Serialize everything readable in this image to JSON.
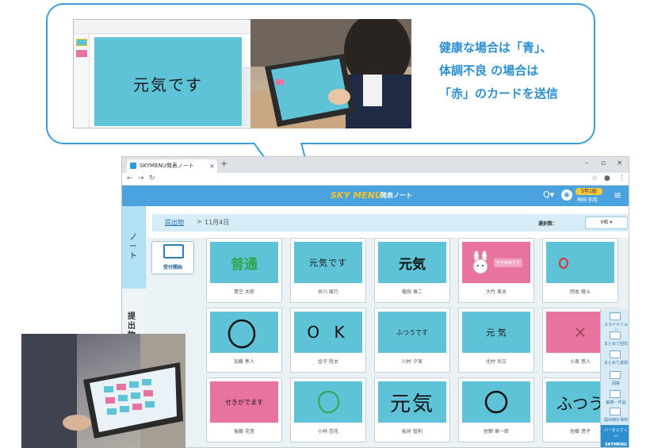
{
  "callout": {
    "mini_card_text": "元気です",
    "message_lines": [
      "健康な場合は「青」、",
      "体調不良 の場合は",
      "「赤」のカードを送信"
    ]
  },
  "browser": {
    "tab_title": "SKYMENU発表ノート",
    "tab_close": "×",
    "new_tab": "+",
    "window_controls": [
      "–",
      "▫",
      "×"
    ]
  },
  "app": {
    "logo": "SKY MENU",
    "title": "発表ノート",
    "user_class": "5年1組",
    "user_name": "梅田 拓哉",
    "rail_note": "ノート",
    "rail_submit": "提出物"
  },
  "breadcrumb": {
    "link": "提出物",
    "sep": ">",
    "date": "11月4日",
    "select_label": "選択数：",
    "select_value": "0枚"
  },
  "receive_button": "受付開始",
  "cards": [
    {
      "text": "普通",
      "name": "青空 太郎",
      "color": "blue",
      "style": "green-bold"
    },
    {
      "text": "元気です",
      "name": "井川 綾乃",
      "color": "blue",
      "style": "plain"
    },
    {
      "text": "元気",
      "name": "植田 章二",
      "color": "blue",
      "style": "bold"
    },
    {
      "text": "かぜ気味です",
      "name": "大竹 美未",
      "color": "pink",
      "style": "bunny"
    },
    {
      "text": "",
      "name": "岡本 隆斗",
      "color": "blue",
      "style": "red-circle"
    },
    {
      "text": "",
      "name": "加藤 隼人",
      "color": "blue",
      "style": "circle"
    },
    {
      "text": "O K",
      "name": "金子 陸太",
      "color": "blue",
      "style": "hand"
    },
    {
      "text": "ふつうです",
      "name": "川村 夕実",
      "color": "blue",
      "style": "small"
    },
    {
      "text": "元 気",
      "name": "北村 尚文",
      "color": "blue",
      "style": "plain"
    },
    {
      "text": "×",
      "name": "小泉 悠人",
      "color": "pink",
      "style": "cross"
    },
    {
      "text": "せきがでます",
      "name": "後藤 花音",
      "color": "pink",
      "style": "small"
    },
    {
      "text": "",
      "name": "小林 芭花",
      "color": "blue",
      "style": "green-circle"
    },
    {
      "text": "元気",
      "name": "桜井 智則",
      "color": "blue",
      "style": "hand-big"
    },
    {
      "text": "",
      "name": "佐野 章一郎",
      "color": "blue",
      "style": "circle"
    },
    {
      "text": "ふつう",
      "name": "佐藤 悠子",
      "color": "blue",
      "style": "hand-big"
    }
  ],
  "right_tools": [
    "スライドショー",
    "まとめて回収",
    "まとめて返却",
    "回答",
    "解答・作品",
    "提出物を保存"
  ],
  "right_tools_bottom": [
    "バーを小さく",
    "SKYMENU"
  ],
  "colors": {
    "accent": "#2d8fd0",
    "card_blue": "#5ec3d7",
    "card_pink": "#e8739e",
    "header": "#4aa3df"
  }
}
